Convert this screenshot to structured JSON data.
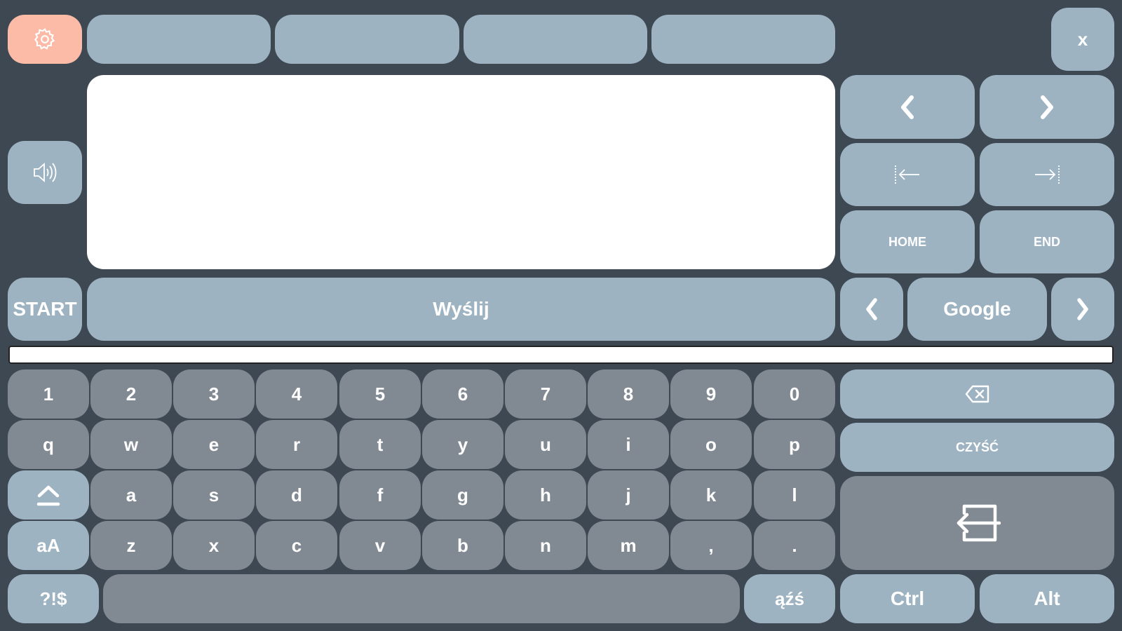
{
  "toolbar": {
    "settings_icon": "gear-icon",
    "tabs": [
      "",
      "",
      "",
      ""
    ],
    "close_label": "x"
  },
  "text_area": {
    "value": ""
  },
  "speak_icon": "speaker-icon",
  "nav": {
    "prev_icon": "chevron-left-icon",
    "next_icon": "chevron-right-icon",
    "word_left_icon": "arrow-left-bar-icon",
    "word_right_icon": "arrow-right-bar-icon",
    "home_label": "HOME",
    "end_label": "END"
  },
  "action_row": {
    "start_label": "START",
    "send_label": "Wyślij",
    "search_label": "Google"
  },
  "suggestion_bar": {
    "value": ""
  },
  "keyboard": {
    "digits": [
      "1",
      "2",
      "3",
      "4",
      "5",
      "6",
      "7",
      "8",
      "9",
      "0"
    ],
    "row_q": [
      "q",
      "w",
      "e",
      "r",
      "t",
      "y",
      "u",
      "i",
      "o",
      "p"
    ],
    "row_a": [
      "a",
      "s",
      "d",
      "f",
      "g",
      "h",
      "j",
      "k",
      "l"
    ],
    "row_z": [
      "z",
      "x",
      "c",
      "v",
      "b",
      "n",
      "m",
      ",",
      "."
    ],
    "case_label": "aA",
    "symbols_label": "?!$",
    "diacritics_label": "ąźś",
    "clear_label": "CZYŚĆ",
    "ctrl_label": "Ctrl",
    "alt_label": "Alt",
    "backspace_icon": "backspace-icon",
    "shift_icon": "shift-icon",
    "enter_icon": "enter-icon"
  },
  "colors": {
    "background": "#3d4852",
    "key_blue": "#9eb3c2",
    "key_gray": "#818a93",
    "accent": "#fbbba7"
  }
}
